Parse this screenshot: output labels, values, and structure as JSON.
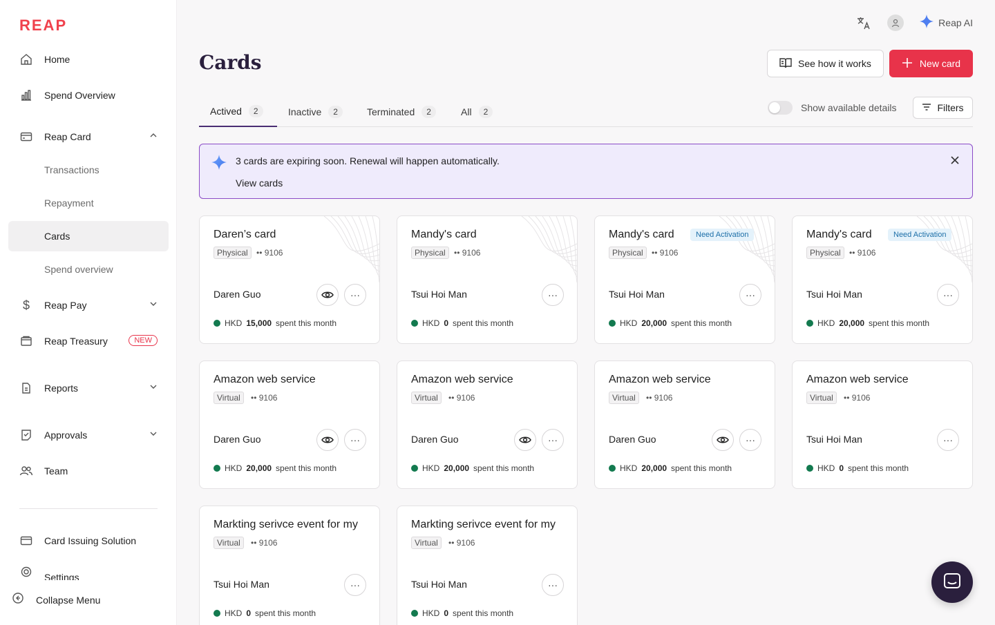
{
  "brand": {
    "logo": "REAP",
    "accent": "#e8334a",
    "primary_dark": "#2a1f3d"
  },
  "sidebar": {
    "items": [
      {
        "label": "Home",
        "icon": "home-icon"
      },
      {
        "label": "Spend Overview",
        "icon": "bar-chart-icon"
      },
      {
        "label": "Reap Card",
        "icon": "card-icon"
      },
      {
        "label": "Transactions"
      },
      {
        "label": "Repayment"
      },
      {
        "label": "Cards"
      },
      {
        "label": "Spend overview"
      },
      {
        "label": "Reap Pay",
        "icon": "dollar-icon"
      },
      {
        "label": "Reap Treasury",
        "icon": "wallet-icon",
        "badge": "NEW"
      },
      {
        "label": "Reports",
        "icon": "report-icon"
      },
      {
        "label": "Approvals",
        "icon": "approval-icon"
      },
      {
        "label": "Team",
        "icon": "team-icon"
      },
      {
        "label": "Card Issuing Solution",
        "icon": "card-issuing-icon"
      },
      {
        "label": "Settings",
        "icon": "gear-icon"
      }
    ],
    "collapse_label": "Collapse Menu"
  },
  "topbar": {
    "reap_ai_label": "Reap AI"
  },
  "header": {
    "title": "Cards",
    "see_how_label": "See how it works",
    "new_card_label": "New card"
  },
  "tabs": [
    {
      "label": "Actived",
      "count": "2"
    },
    {
      "label": "Inactive",
      "count": "2"
    },
    {
      "label": "Terminated",
      "count": "2"
    },
    {
      "label": "All",
      "count": "2"
    }
  ],
  "toggle_label": "Show available details",
  "filters_label": "Filters",
  "banner": {
    "message": "3 cards are expiring soon. Renewal will happen automatically.",
    "link": "View cards"
  },
  "cards": [
    {
      "name": "Daren’s card",
      "type": "Physical",
      "last4": "•• 9106",
      "owner": "Daren Guo",
      "currency": "HKD",
      "amount": "15,000",
      "suffix": "spent this month",
      "badge": ""
    },
    {
      "name": "Mandy's card",
      "type": "Physical",
      "last4": "•• 9106",
      "owner": "Tsui Hoi Man",
      "currency": "HKD",
      "amount": "0",
      "suffix": "spent this month",
      "badge": ""
    },
    {
      "name": "Mandy's card",
      "type": "Physical",
      "last4": "•• 9106",
      "owner": "Tsui Hoi Man",
      "currency": "HKD",
      "amount": "20,000",
      "suffix": "spent this month",
      "badge": "Need Activation"
    },
    {
      "name": "Mandy's card",
      "type": "Physical",
      "last4": "•• 9106",
      "owner": "Tsui Hoi Man",
      "currency": "HKD",
      "amount": "20,000",
      "suffix": "spent this month",
      "badge": "Need Activation"
    },
    {
      "name": "Amazon web service",
      "type": "Virtual",
      "last4": "•• 9106",
      "owner": "Daren Guo",
      "currency": "HKD",
      "amount": "20,000",
      "suffix": "spent this month",
      "badge": ""
    },
    {
      "name": "Amazon web service",
      "type": "Virtual",
      "last4": "•• 9106",
      "owner": "Daren Guo",
      "currency": "HKD",
      "amount": "20,000",
      "suffix": "spent this month",
      "badge": ""
    },
    {
      "name": "Amazon web service",
      "type": "Virtual",
      "last4": "•• 9106",
      "owner": "Daren Guo",
      "currency": "HKD",
      "amount": "20,000",
      "suffix": "spent this month",
      "badge": ""
    },
    {
      "name": "Amazon web service",
      "type": "Virtual",
      "last4": "•• 9106",
      "owner": "Tsui Hoi Man",
      "currency": "HKD",
      "amount": "0",
      "suffix": "spent this month",
      "badge": ""
    },
    {
      "name": "Markting serivce event for my",
      "type": "Virtual",
      "last4": "•• 9106",
      "owner": "Tsui Hoi Man",
      "currency": "HKD",
      "amount": "0",
      "suffix": "spent this month",
      "badge": ""
    },
    {
      "name": "Markting serivce event for my",
      "type": "Virtual",
      "last4": "•• 9106",
      "owner": "Tsui Hoi Man",
      "currency": "HKD",
      "amount": "0",
      "suffix": "spent this month",
      "badge": ""
    }
  ]
}
